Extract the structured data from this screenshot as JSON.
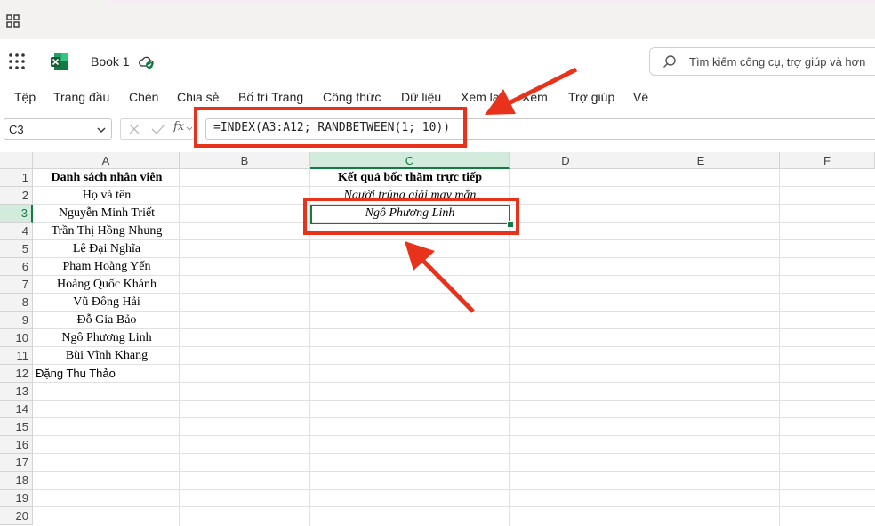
{
  "app": {
    "book_title": "Book 1"
  },
  "search": {
    "placeholder": "Tìm kiếm công cụ, trợ giúp và hơn"
  },
  "ribbon": {
    "tabs": [
      "Tệp",
      "Trang đầu",
      "Chèn",
      "Chia sẻ",
      "Bố trí Trang",
      "Công thức",
      "Dữ liệu",
      "Xem lại",
      "Xem",
      "Trợ giúp",
      "Vẽ"
    ]
  },
  "formula_bar": {
    "name_box": "C3",
    "fx_label": "fx",
    "formula": "=INDEX(A3:A12; RANDBETWEEN(1; 10))"
  },
  "sheet": {
    "columns": [
      "A",
      "B",
      "C",
      "D",
      "E",
      "F"
    ],
    "selected_column": "C",
    "rows": [
      "1",
      "2",
      "3",
      "4",
      "5",
      "6",
      "7",
      "8",
      "9",
      "10",
      "11",
      "12",
      "13",
      "14",
      "15",
      "16",
      "17",
      "18",
      "19",
      "20"
    ],
    "selected_row": "3",
    "active_cell": "C3",
    "column_a": {
      "header": "Danh sách nhân viên",
      "subheader": "Họ và tên",
      "names": [
        "Nguyễn Minh Triết",
        "Trần Thị Hồng Nhung",
        "Lê Đại Nghĩa",
        "Phạm Hoàng Yến",
        "Hoàng Quốc Khánh",
        "Vũ Đông Hải",
        "Đỗ Gia Bảo",
        "Ngô Phương Linh",
        "Bùi Vĩnh Khang"
      ],
      "row12": "Đặng Thu Thảo"
    },
    "column_c": {
      "header": "Kết quả bốc thăm trực tiếp",
      "subheader": "Người trúng giải may mắn",
      "result": "Ngô Phương Linh"
    }
  },
  "colors": {
    "accent_green": "#107c41",
    "annotation_red": "#e8321c"
  }
}
